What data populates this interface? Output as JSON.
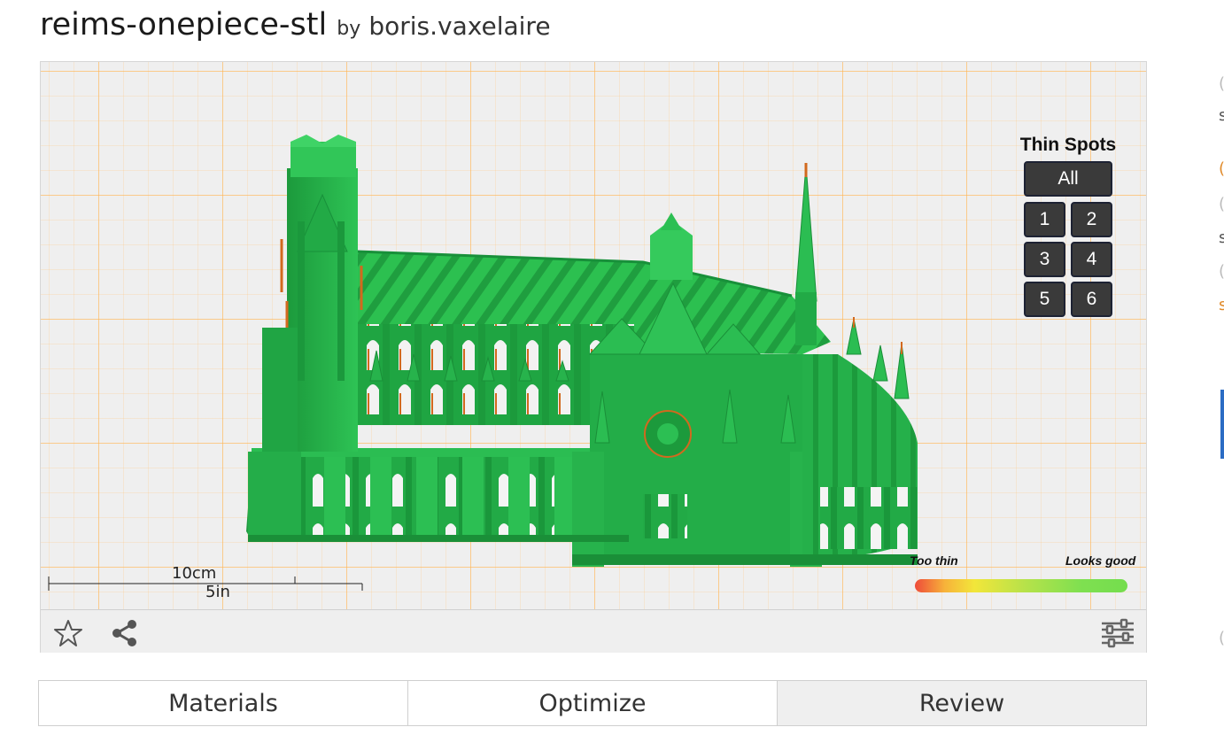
{
  "header": {
    "model_name": "reims-onepiece-stl",
    "by_label": "by",
    "author": "boris.vaxelaire"
  },
  "viewer": {
    "thin_spots": {
      "title": "Thin Spots",
      "all_label": "All",
      "buttons": [
        "1",
        "2",
        "3",
        "4",
        "5",
        "6"
      ]
    },
    "scale": {
      "metric_label": "10cm",
      "imperial_label": "5in"
    },
    "legend": {
      "low_label": "Too thin",
      "high_label": "Looks good",
      "colors": [
        "#ee4b3a",
        "#f2e63a",
        "#74dd4e"
      ]
    },
    "toolbar_icons": [
      "star-icon",
      "share-icon",
      "settings-sliders-icon"
    ],
    "model_color": "#23b04a",
    "grid_color": "#ffb450"
  },
  "tabs": [
    {
      "label": "Materials",
      "active": false
    },
    {
      "label": "Optimize",
      "active": false
    },
    {
      "label": "Review",
      "active": true
    }
  ]
}
